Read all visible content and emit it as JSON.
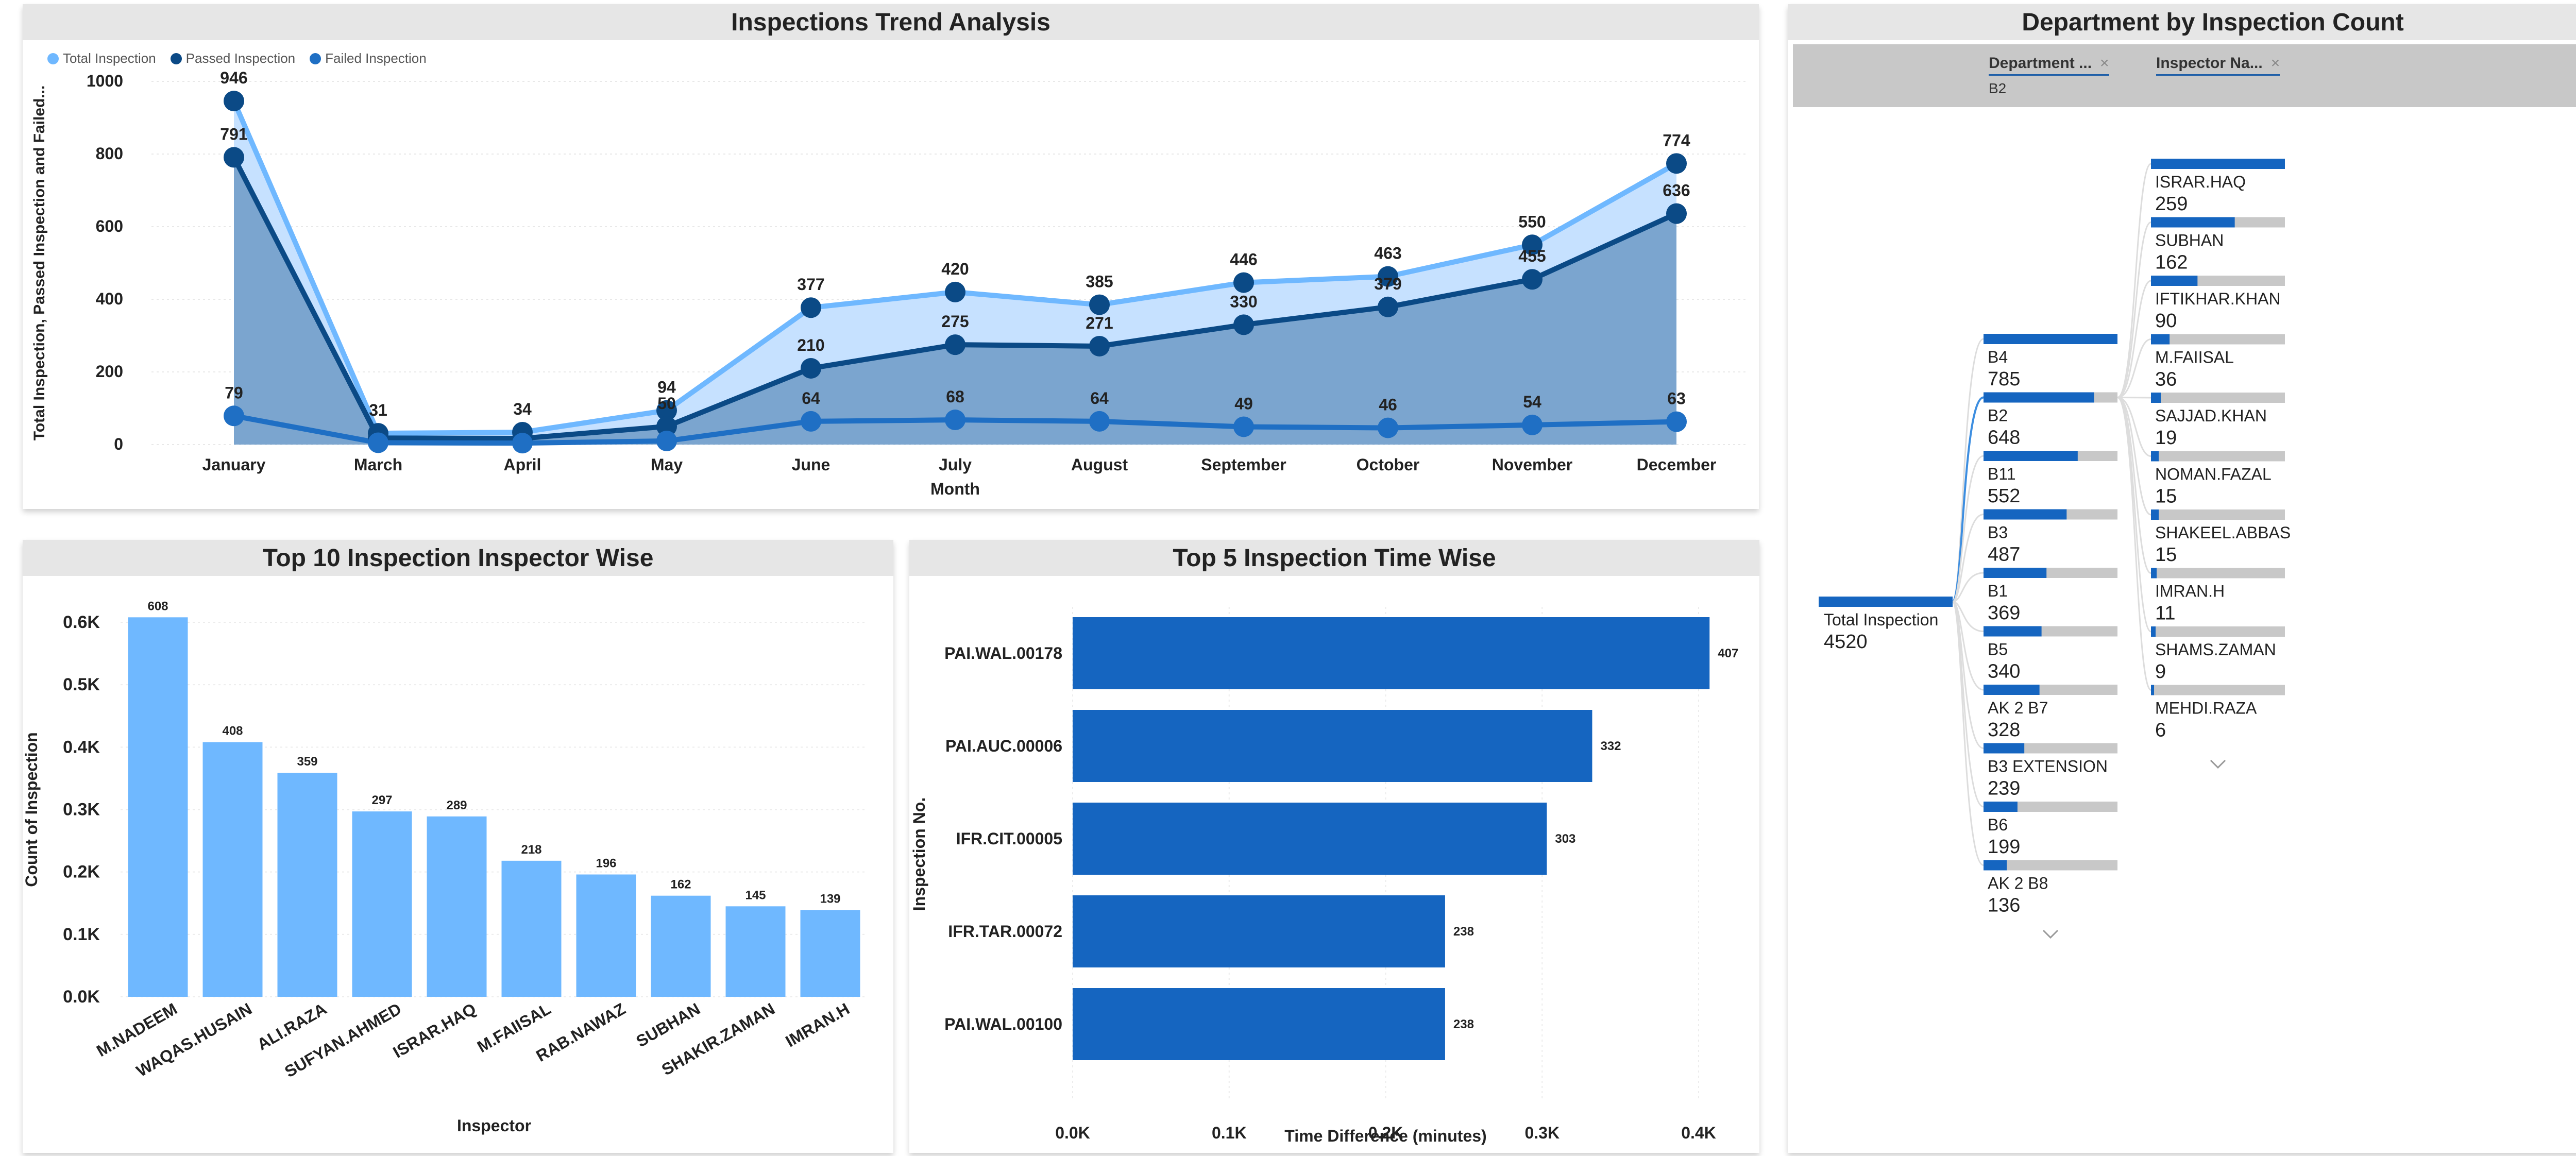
{
  "colors": {
    "total": "#6fb8ff",
    "passed": "#0b4a86",
    "failed": "#1f6fc4",
    "bar_light": "#6fb8ff",
    "bar_dark": "#1565c0",
    "track": "#c8c8c8",
    "accent": "#1565c0"
  },
  "trend": {
    "title": "Inspections Trend Analysis",
    "legend": [
      "Total Inspection",
      "Passed Inspection",
      "Failed Inspection"
    ],
    "ylabel": "Total Inspection, Passed Inspection and Failed...",
    "xlabel": "Month"
  },
  "inspector": {
    "title": "Top 10 Inspection Inspector Wise",
    "ylabel": "Count of Inspection",
    "xlabel": "Inspector"
  },
  "timewise": {
    "title": "Top 5 Inspection Time Wise",
    "ylabel": "Inspection No.",
    "xlabel": "Time Difference (minutes)"
  },
  "dept": {
    "title": "Department by Inspection Count",
    "filter1": "Department ...",
    "filter2": "Inspector Na...",
    "close_glyph": "×",
    "breadcrumb": "B2",
    "root_label": "Total Inspection",
    "root_value": "4520",
    "departments": [
      {
        "name": "B4",
        "value": "785",
        "n": 785
      },
      {
        "name": "B2",
        "value": "648",
        "n": 648
      },
      {
        "name": "B11",
        "value": "552",
        "n": 552
      },
      {
        "name": "B3",
        "value": "487",
        "n": 487
      },
      {
        "name": "B1",
        "value": "369",
        "n": 369
      },
      {
        "name": "B5",
        "value": "340",
        "n": 340
      },
      {
        "name": "AK 2 B7",
        "value": "328",
        "n": 328
      },
      {
        "name": "B3 EXTENSION",
        "value": "239",
        "n": 239
      },
      {
        "name": "B6",
        "value": "199",
        "n": 199
      },
      {
        "name": "AK 2 B8",
        "value": "136",
        "n": 136
      }
    ],
    "inspectors": [
      {
        "name": "ISRAR.HAQ",
        "value": "259",
        "n": 259
      },
      {
        "name": "SUBHAN",
        "value": "162",
        "n": 162
      },
      {
        "name": "IFTIKHAR.KHAN",
        "value": "90",
        "n": 90
      },
      {
        "name": "M.FAIISAL",
        "value": "36",
        "n": 36
      },
      {
        "name": "SAJJAD.KHAN",
        "value": "19",
        "n": 19
      },
      {
        "name": "NOMAN.FAZAL",
        "value": "15",
        "n": 15
      },
      {
        "name": "SHAKEEL.ABBAS",
        "value": "15",
        "n": 15
      },
      {
        "name": "IMRAN.H",
        "value": "11",
        "n": 11
      },
      {
        "name": "SHAMS.ZAMAN",
        "value": "9",
        "n": 9
      },
      {
        "name": "MEHDI.RAZA",
        "value": "6",
        "n": 6
      }
    ]
  },
  "chart_data": [
    {
      "type": "area",
      "title": "Inspections Trend Analysis",
      "xlabel": "Month",
      "ylabel": "Total Inspection, Passed Inspection and Failed...",
      "categories": [
        "January",
        "March",
        "April",
        "May",
        "June",
        "July",
        "August",
        "September",
        "October",
        "November",
        "December"
      ],
      "ylim": [
        0,
        1000
      ],
      "yticks": [
        "0",
        "200",
        "400",
        "600",
        "800",
        "1000"
      ],
      "legend_position": "top-left",
      "series": [
        {
          "name": "Total Inspection",
          "values": [
            946,
            31,
            34,
            94,
            377,
            420,
            385,
            446,
            463,
            550,
            774
          ]
        },
        {
          "name": "Passed Inspection",
          "values": [
            791,
            18,
            17,
            50,
            210,
            275,
            271,
            330,
            379,
            455,
            636
          ]
        },
        {
          "name": "Failed Inspection",
          "values": [
            79,
            5,
            4,
            10,
            64,
            68,
            64,
            49,
            46,
            54,
            63
          ]
        }
      ],
      "labels": [
        [
          "946",
          "31",
          "34",
          "94",
          "377",
          "420",
          "385",
          "446",
          "463",
          "550",
          "774"
        ],
        [
          "791",
          "",
          "",
          "50",
          "210",
          "275",
          "271",
          "330",
          "379",
          "455",
          "636"
        ],
        [
          "79",
          "",
          "",
          "",
          "64",
          "68",
          "64",
          "49",
          "46",
          "54",
          "63"
        ]
      ]
    },
    {
      "type": "bar",
      "title": "Top 10 Inspection Inspector Wise",
      "xlabel": "Inspector",
      "ylabel": "Count of Inspection",
      "categories": [
        "M.NADEEM",
        "WAQAS.HUSAIN",
        "ALI.RAZA",
        "SUFYAN.AHMED",
        "ISRAR.HAQ",
        "M.FAIISAL",
        "RAB.NAWAZ",
        "SUBHAN",
        "SHAKIR.ZAMAN",
        "IMRAN.H"
      ],
      "values": [
        608,
        408,
        359,
        297,
        289,
        218,
        196,
        162,
        145,
        139
      ],
      "ylim": [
        0,
        600
      ],
      "yticks": [
        "0.0K",
        "0.1K",
        "0.2K",
        "0.3K",
        "0.4K",
        "0.5K",
        "0.6K"
      ]
    },
    {
      "type": "bar",
      "orientation": "horizontal",
      "title": "Top 5 Inspection Time Wise",
      "xlabel": "Time Difference (minutes)",
      "ylabel": "Inspection No.",
      "categories": [
        "PAI.WAL.00178",
        "PAI.AUC.00006",
        "IFR.CIT.00005",
        "IFR.TAR.00072",
        "PAI.WAL.00100"
      ],
      "values": [
        407,
        332,
        303,
        238,
        238
      ],
      "xlim": [
        0,
        400
      ],
      "xticks": [
        "0.0K",
        "0.1K",
        "0.2K",
        "0.3K",
        "0.4K"
      ]
    }
  ]
}
